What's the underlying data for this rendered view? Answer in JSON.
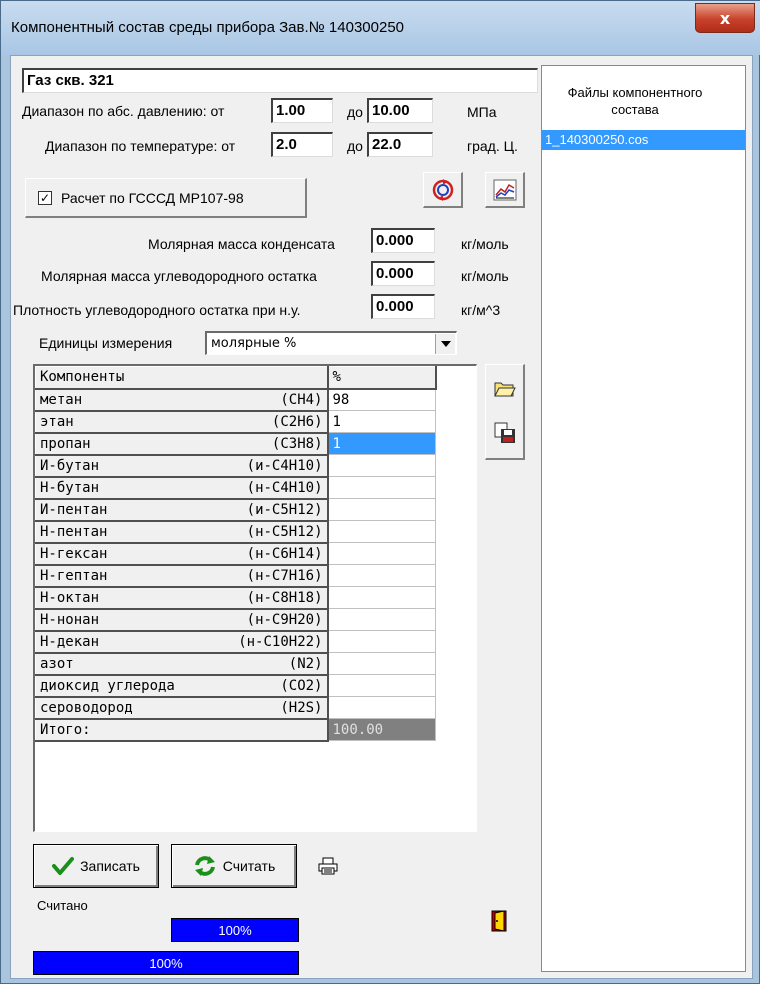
{
  "window": {
    "title": "Компонентный состав среды прибора Зав.№ 140300250",
    "close_label": "x"
  },
  "name_field": "Газ скв. 321",
  "pressure": {
    "label": "Диапазон по абс. давлению: от",
    "from": "1.00",
    "to_label": "до",
    "to": "10.00",
    "unit": "МПа"
  },
  "temperature": {
    "label": "Диапазон по температуре: от",
    "from": "2.0",
    "to_label": "до",
    "to": "22.0",
    "unit": "град. Ц."
  },
  "gsssd": {
    "checkbox_mark": "✓",
    "label": "Расчет по ГСССД МР107-98",
    "checked": true
  },
  "condensate_mass": {
    "label": "Молярная масса конденсата",
    "value": "0.000",
    "unit": "кг/моль"
  },
  "hydrocarbon_mass": {
    "label": "Молярная масса углеводородного остатка",
    "value": "0.000",
    "unit": "кг/моль"
  },
  "hydrocarbon_density": {
    "label": "Плотность углеводородного остатка при н.у.",
    "value": "0.000",
    "unit": "кг/м^3"
  },
  "units": {
    "label": "Единицы измерения",
    "selected": "молярные %"
  },
  "grid": {
    "header_name": "Компоненты",
    "header_value": "%",
    "rows": [
      {
        "name": "метан",
        "formula": "(CH4)",
        "value": "98"
      },
      {
        "name": "этан",
        "formula": "(C2H6)",
        "value": "1"
      },
      {
        "name": "пропан",
        "formula": "(C3H8)",
        "value": "1"
      },
      {
        "name": "И-бутан",
        "formula": "(и-C4H10)",
        "value": ""
      },
      {
        "name": "Н-бутан",
        "formula": "(н-C4H10)",
        "value": ""
      },
      {
        "name": "И-пентан",
        "formula": "(и-C5H12)",
        "value": ""
      },
      {
        "name": "Н-пентан",
        "formula": "(н-C5H12)",
        "value": ""
      },
      {
        "name": "Н-гексан",
        "formula": "(н-C6H14)",
        "value": ""
      },
      {
        "name": "Н-гептан",
        "formula": "(н-C7H16)",
        "value": ""
      },
      {
        "name": "Н-октан",
        "formula": "(н-C8H18)",
        "value": ""
      },
      {
        "name": "Н-нонан",
        "formula": "(н-C9H20)",
        "value": ""
      },
      {
        "name": "Н-декан",
        "formula": "(н-C10H22)",
        "value": ""
      },
      {
        "name": "азот",
        "formula": "(N2)",
        "value": ""
      },
      {
        "name": "диоксид углерода",
        "formula": "(CO2)",
        "value": ""
      },
      {
        "name": "сероводород",
        "formula": "(H2S)",
        "value": ""
      }
    ],
    "total_label": "Итого:",
    "total_value": "100.00"
  },
  "buttons": {
    "save": "Записать",
    "read": "Считать"
  },
  "status": "Считано",
  "progress1": {
    "value": 100,
    "label": "100%"
  },
  "progress2": {
    "value": 100,
    "label": "100%"
  },
  "files": {
    "header": "Файлы компонентного состава",
    "items": [
      "1_140300250.cos"
    ]
  },
  "colors": {
    "selection": "#3399ff",
    "progress": "#0000ff"
  }
}
